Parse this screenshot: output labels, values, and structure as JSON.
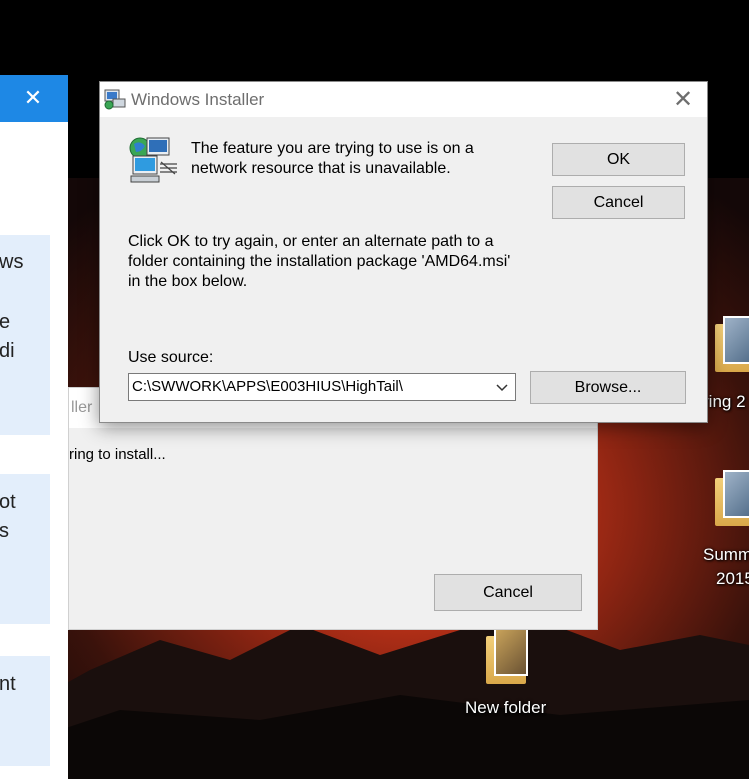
{
  "side_panel": {
    "close_icon": "close-icon",
    "cards": [
      {
        "lines": [
          "ws",
          "",
          "e",
          "di"
        ]
      },
      {
        "lines": [
          "ot",
          "s"
        ]
      },
      {
        "lines": [
          "nt"
        ]
      }
    ]
  },
  "background_dialog": {
    "title_fragment": "ller",
    "status_text": "ring to install...",
    "cancel_label": "Cancel"
  },
  "desktop_icons": [
    {
      "label": "ring 2"
    },
    {
      "label": "Summ"
    },
    {
      "label": "2015"
    },
    {
      "label": "New folder"
    }
  ],
  "dialog": {
    "title": "Windows Installer",
    "message_lines": [
      "The feature you are trying to use is on a",
      "network resource that is unavailable."
    ],
    "instruction_lines": [
      "Click OK to try again, or enter an alternate path to a",
      "folder containing the installation package 'AMD64.msi'",
      "in the box below."
    ],
    "use_source_label": "Use source:",
    "use_source_value": "C:\\SWWORK\\APPS\\E003HIUS\\HighTail\\",
    "ok_label": "OK",
    "cancel_label": "Cancel",
    "browse_label": "Browse..."
  },
  "colors": {
    "accent": "#1e88e5",
    "dialog_bg": "#f0f0f0",
    "button_bg": "#e1e1e1"
  }
}
